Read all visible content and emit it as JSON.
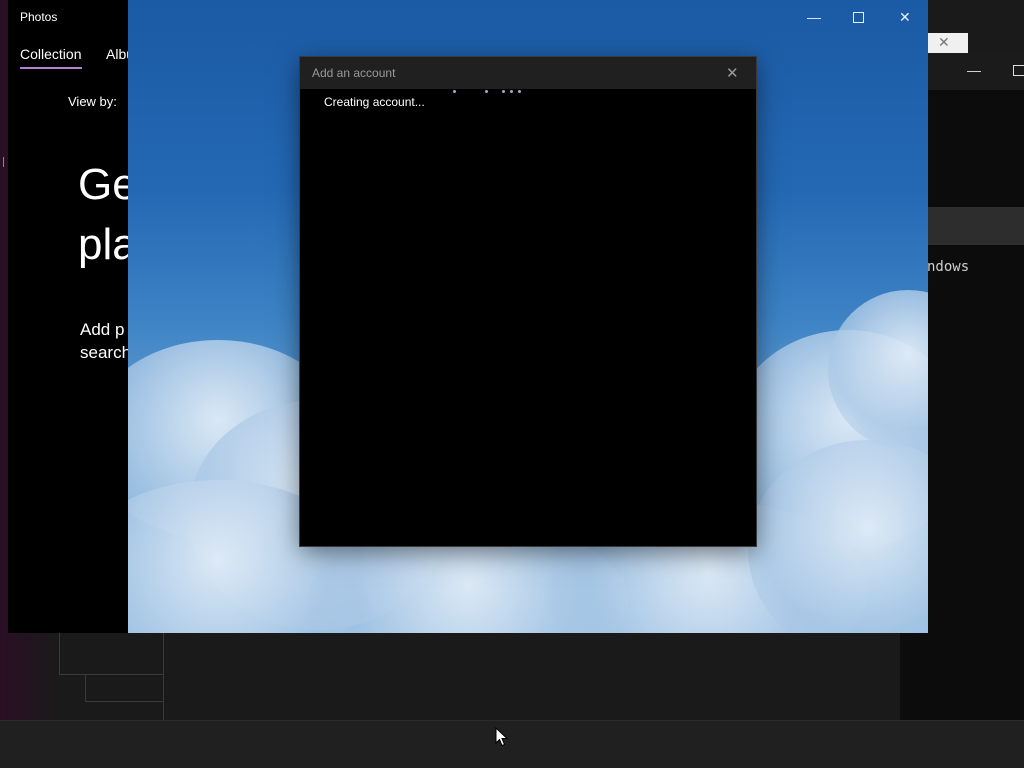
{
  "photos_app": {
    "title": "Photos",
    "tabs": [
      {
        "label": "Collection",
        "selected": true
      },
      {
        "label": "Albu",
        "selected": false
      }
    ],
    "view_by_label": "View by:",
    "hero_line1": "Ge",
    "hero_line2": "pla",
    "desc_line1": "Add p",
    "desc_line2": "search",
    "accent_color": "#b77fd7"
  },
  "sky_window": {
    "minimize_glyph": "—",
    "close_glyph": "✕"
  },
  "dialog": {
    "title": "Add an account",
    "close_glyph": "✕",
    "status_text": "Creating account...",
    "progress_dots_color": "#b79ad0"
  },
  "background_window": {
    "text": "ndows",
    "tab_close_glyph": "✕",
    "minimize_glyph": "—"
  }
}
